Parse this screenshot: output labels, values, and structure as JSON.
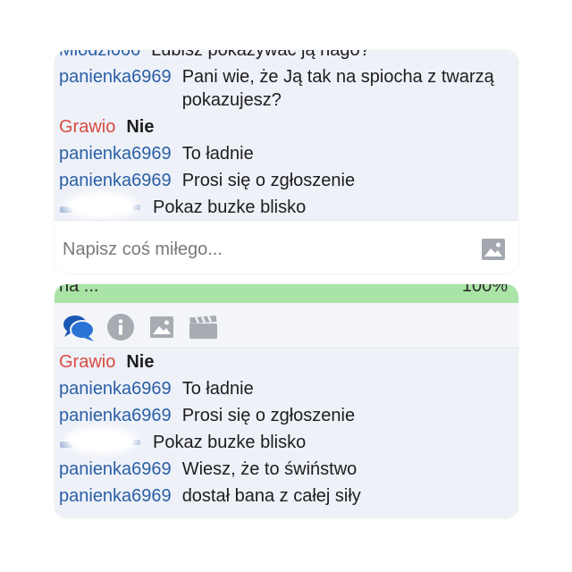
{
  "colors": {
    "page_background": "#ffffff",
    "panel_background": "#eef1f8",
    "username_blue": "#2a5fa6",
    "username_red": "#d94b3f",
    "status_bar_green": "#a9e4a6",
    "icon_blue": "#1f66c6",
    "icon_gray": "#a7abb2"
  },
  "top_panel": {
    "messages": [
      {
        "user": "Mlodzi666",
        "text": "Lubisz pokazywać ją nago?"
      },
      {
        "user": "panienka6969",
        "text": "Pani wie, że Ją tak na spiocha z twarzą pokazujesz?"
      },
      {
        "user": "Grawio",
        "text": "Nie"
      },
      {
        "user": "panienka6969",
        "text": "To ładnie"
      },
      {
        "user": "panienka6969",
        "text": "Prosi się o zgłoszenie"
      },
      {
        "user_redacted": true,
        "text": "Pokaz buzke blisko"
      }
    ],
    "composer": {
      "placeholder": "Napisz coś miłego...",
      "attach_icon": "image-icon"
    }
  },
  "bottom_panel": {
    "status_bar": {
      "left_text": "na ...",
      "right_text": "100%"
    },
    "toolbar": {
      "icons": [
        "chat-bubbles-icon",
        "info-icon",
        "image-icon",
        "clapperboard-icon"
      ],
      "active": "chat-bubbles-icon"
    },
    "messages": [
      {
        "user": "Grawio",
        "text": "Nie"
      },
      {
        "user": "panienka6969",
        "text": "To ładnie"
      },
      {
        "user": "panienka6969",
        "text": "Prosi się o zgłoszenie"
      },
      {
        "user_redacted": true,
        "text": "Pokaz buzke blisko"
      },
      {
        "user": "panienka6969",
        "text": "Wiesz, że to świństwo"
      },
      {
        "user": "panienka6969",
        "text": "dostał bana z całej siły"
      }
    ]
  }
}
